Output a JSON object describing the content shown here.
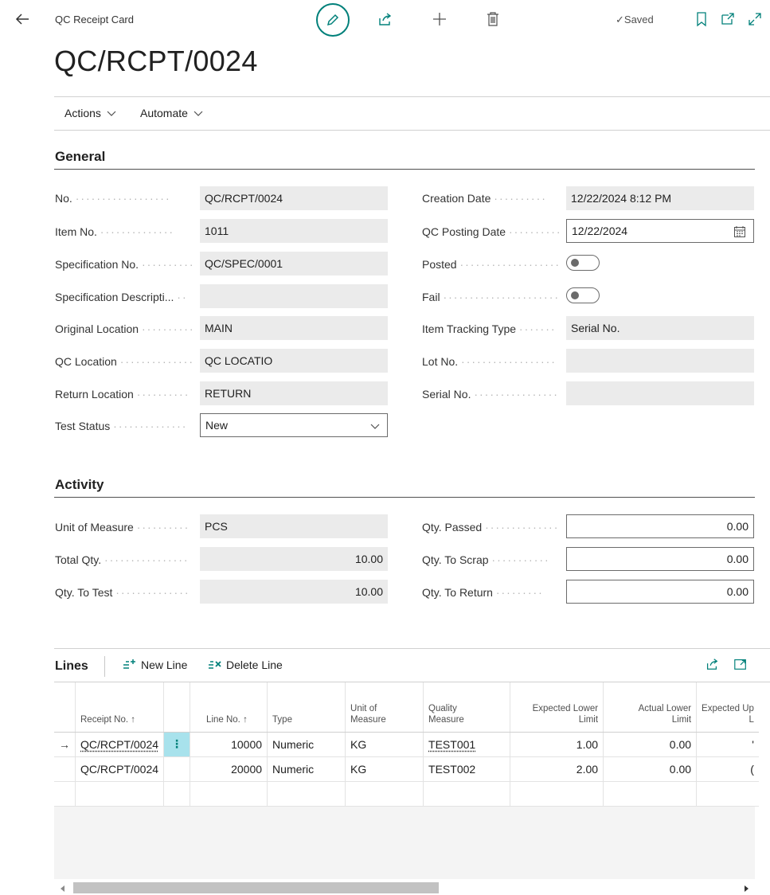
{
  "header": {
    "caption": "QC Receipt Card",
    "title": "QC/RCPT/0024",
    "saved_label": "Saved"
  },
  "menu": {
    "actions": "Actions",
    "automate": "Automate"
  },
  "general": {
    "title": "General",
    "left": [
      {
        "label": "No.",
        "value": "QC/RCPT/0024"
      },
      {
        "label": "Item No.",
        "value": "1011"
      },
      {
        "label": "Specification No.",
        "value": "QC/SPEC/0001"
      },
      {
        "label": "Specification Descripti...",
        "value": ""
      },
      {
        "label": "Original Location",
        "value": "MAIN"
      },
      {
        "label": "QC Location",
        "value": "QC LOCATIO"
      },
      {
        "label": "Return Location",
        "value": "RETURN"
      },
      {
        "label": "Test Status",
        "value": "New"
      }
    ],
    "right": [
      {
        "label": "Creation Date",
        "value": "12/22/2024 8:12 PM"
      },
      {
        "label": "QC Posting Date",
        "value": "12/22/2024"
      },
      {
        "label": "Posted",
        "value": false
      },
      {
        "label": "Fail",
        "value": false
      },
      {
        "label": "Item Tracking Type",
        "value": "Serial No."
      },
      {
        "label": "Lot No.",
        "value": ""
      },
      {
        "label": "Serial No.",
        "value": ""
      }
    ]
  },
  "activity": {
    "title": "Activity",
    "left": [
      {
        "label": "Unit of Measure",
        "value": "PCS"
      },
      {
        "label": "Total Qty.",
        "value": "10.00"
      },
      {
        "label": "Qty. To Test",
        "value": "10.00"
      }
    ],
    "right": [
      {
        "label": "Qty. Passed",
        "value": "0.00"
      },
      {
        "label": "Qty. To Scrap",
        "value": "0.00"
      },
      {
        "label": "Qty. To Return",
        "value": "0.00"
      }
    ]
  },
  "lines": {
    "title": "Lines",
    "new_line": "New Line",
    "delete_line": "Delete Line",
    "columns": {
      "receipt_no": "Receipt No. ↑",
      "line_no": "Line No. ↑",
      "type": "Type",
      "uom_1": "Unit of",
      "uom_2": "Measure",
      "qm_1": "Quality",
      "qm_2": "Measure",
      "ell_1": "Expected Lower",
      "ell_2": "Limit",
      "all_1": "Actual Lower",
      "all_2": "Limit",
      "eul_1": "Expected Up",
      "eul_2": "L"
    },
    "rows": [
      {
        "receipt_no": "QC/RCPT/0024",
        "line_no": "10000",
        "type": "Numeric",
        "uom": "KG",
        "quality_measure": "TEST001",
        "expected_lower": "1.00",
        "actual_lower": "0.00",
        "expected_upper": "'"
      },
      {
        "receipt_no": "QC/RCPT/0024",
        "line_no": "20000",
        "type": "Numeric",
        "uom": "KG",
        "quality_measure": "TEST002",
        "expected_lower": "2.00",
        "actual_lower": "0.00",
        "expected_upper": "("
      }
    ]
  },
  "colors": {
    "accent": "#00807a",
    "selected_cell": "#a8e2ec"
  }
}
